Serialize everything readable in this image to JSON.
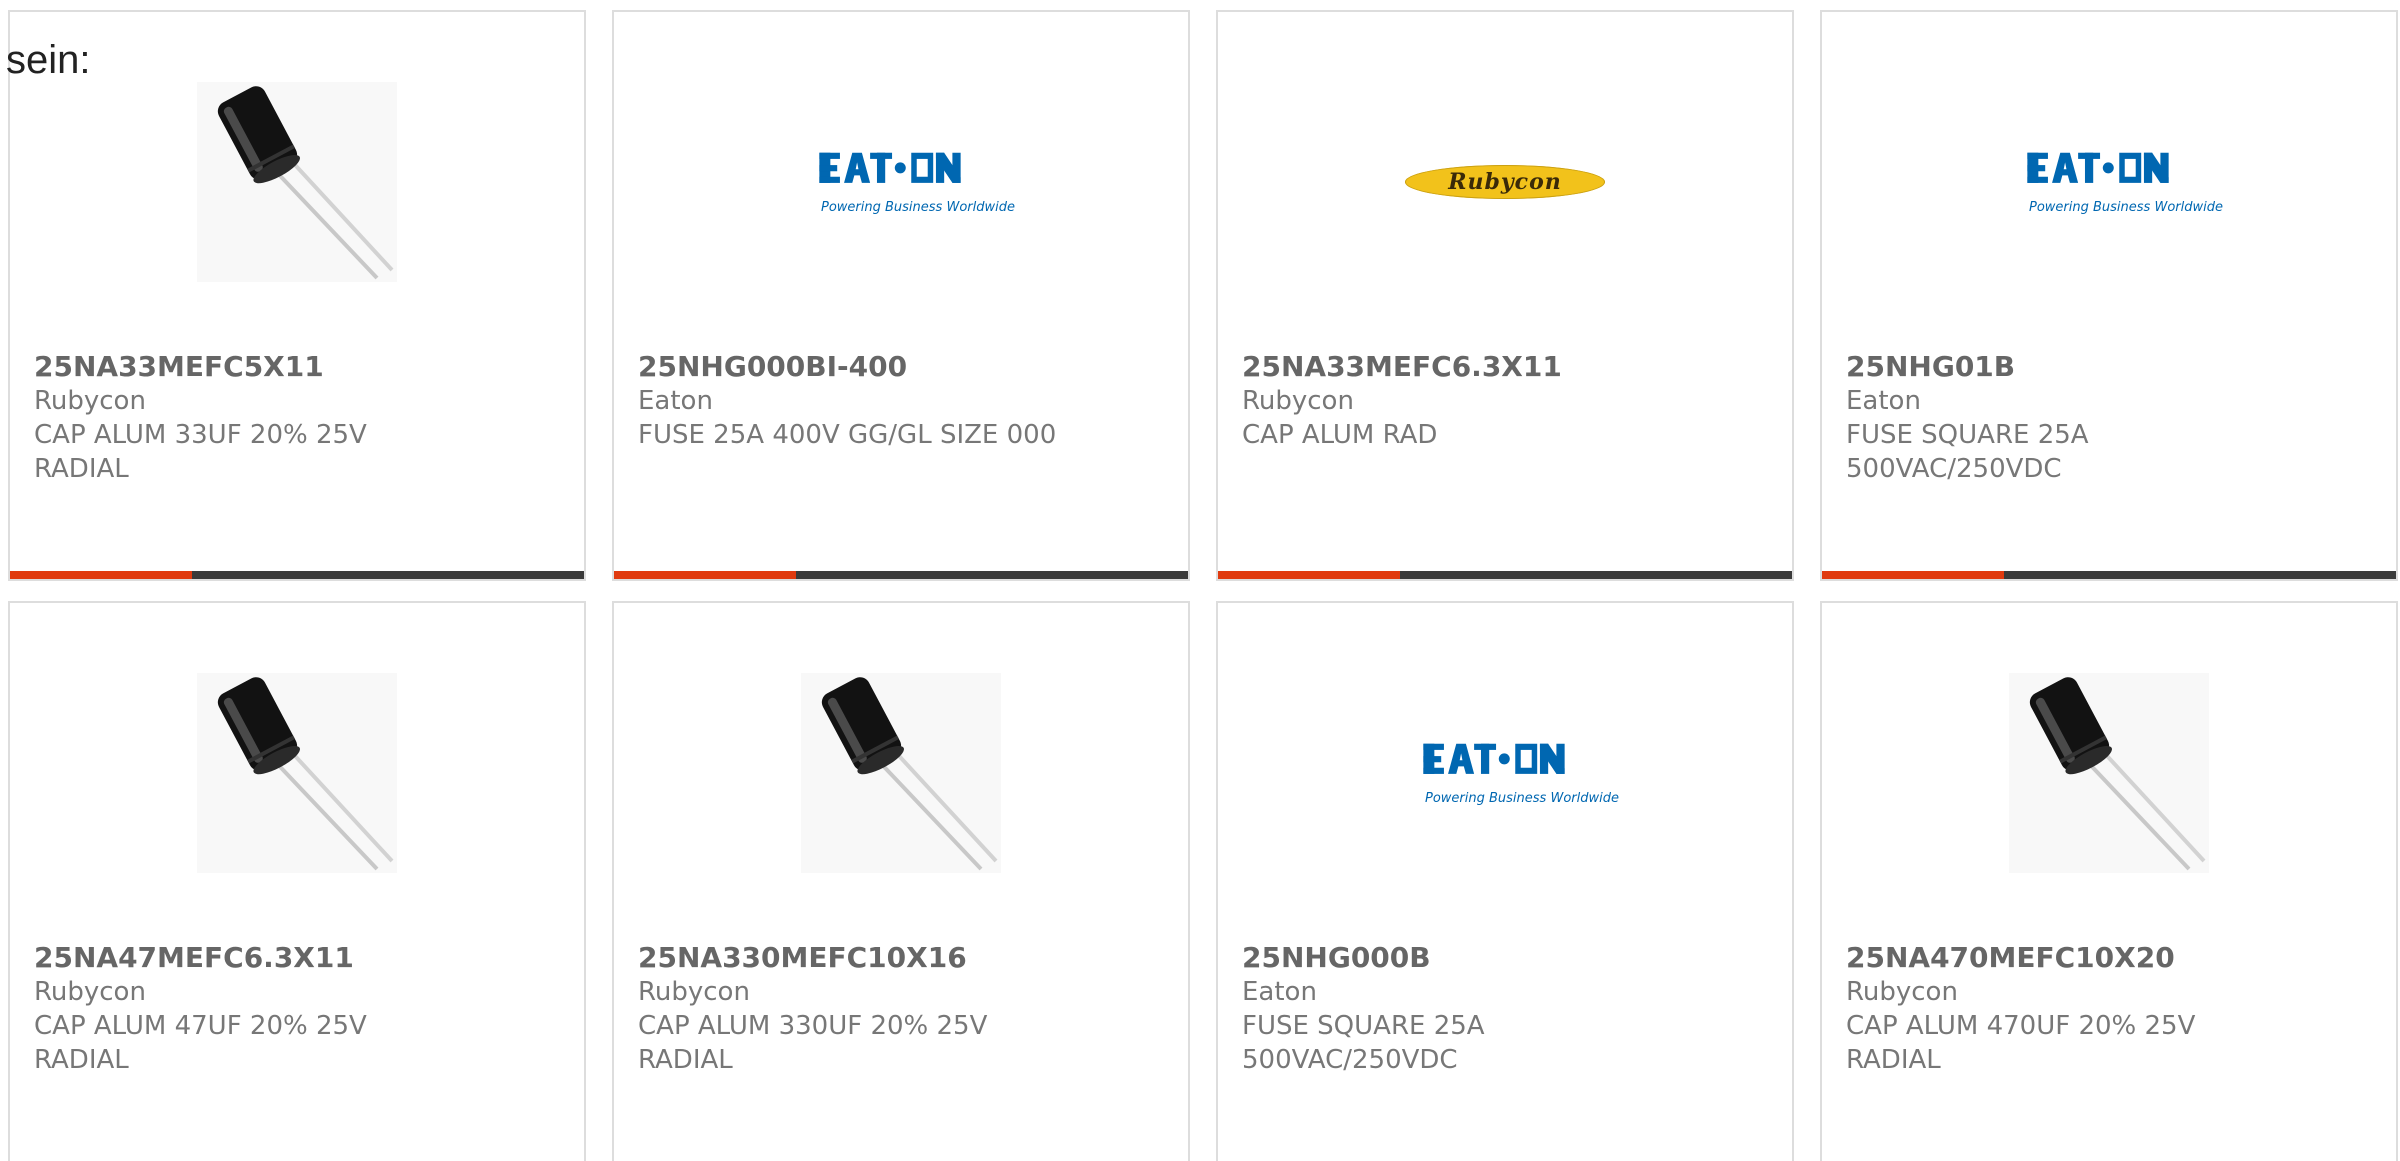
{
  "intro_text": "sein:",
  "colors": {
    "accent": "#e03a0f",
    "bar_dark": "#3a3a3a",
    "eaton_blue": "#0067b1",
    "rubycon_yellow": "#f2c21b"
  },
  "products": [
    {
      "part": "25NA33MEFC5X11",
      "maker": "Rubycon",
      "desc": "CAP ALUM 33UF 20% 25V RADIAL",
      "image": "capacitor-photo"
    },
    {
      "part": "25NHG000BI-400",
      "maker": "Eaton",
      "desc": "FUSE 25A 400V GG/GL SIZE 000",
      "image": "eaton-logo"
    },
    {
      "part": "25NA33MEFC6.3X11",
      "maker": "Rubycon",
      "desc": "CAP ALUM RAD",
      "image": "rubycon-logo"
    },
    {
      "part": "25NHG01B",
      "maker": "Eaton",
      "desc": "FUSE SQUARE 25A 500VAC/250VDC",
      "image": "eaton-logo"
    },
    {
      "part": "25NA47MEFC6.3X11",
      "maker": "Rubycon",
      "desc": "CAP ALUM 47UF 20% 25V RADIAL",
      "image": "capacitor-photo"
    },
    {
      "part": "25NA330MEFC10X16",
      "maker": "Rubycon",
      "desc": "CAP ALUM 330UF 20% 25V RADIAL",
      "image": "capacitor-photo"
    },
    {
      "part": "25NHG000B",
      "maker": "Eaton",
      "desc": "FUSE SQUARE 25A 500VAC/250VDC",
      "image": "eaton-logo"
    },
    {
      "part": "25NA470MEFC10X20",
      "maker": "Rubycon",
      "desc": "CAP ALUM 470UF 20% 25V RADIAL",
      "image": "capacitor-photo"
    }
  ],
  "logos": {
    "eaton_wordmark": "EATON",
    "eaton_tagline": "Powering Business Worldwide",
    "rubycon_wordmark": "Rubycon"
  }
}
